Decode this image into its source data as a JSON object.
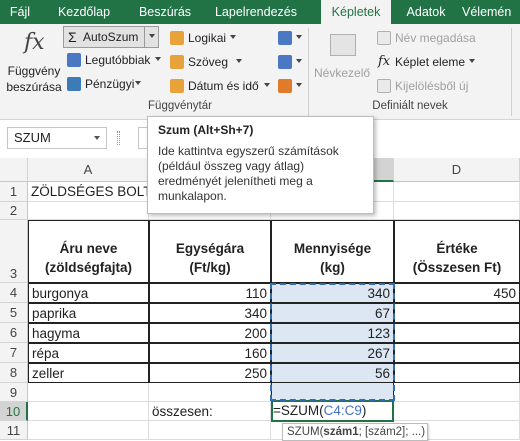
{
  "ribbon_tabs": [
    "Fájl",
    "Kezdőlap",
    "Beszúrás",
    "Lapelrendezés",
    "Képletek",
    "Adatok",
    "Vélemén"
  ],
  "ribbon": {
    "insert_function_label_1": "Függvény",
    "insert_function_label_2": "beszúrása",
    "autosum": "AutoSzum",
    "recent": "Legutóbbiak",
    "financial": "Pénzügyi",
    "logical": "Logikai",
    "text": "Szöveg",
    "datetime": "Dátum és idő",
    "name_manager": "Névkezelő",
    "define_name": "Név megadása",
    "use_in_formula": "Képlet eleme",
    "create_from_selection": "Kijelölésből új",
    "group_library": "Függvénytár",
    "group_names": "Definiált nevek"
  },
  "formula_bar": {
    "name_box": "SZUM"
  },
  "tooltip": {
    "title": "Szum (Alt+Sh+7)",
    "lines": [
      "Ide kattintva egyszerű számítások",
      "(például összeg vagy átlag)",
      "eredményét jelenítheti meg a",
      "munkalapon."
    ]
  },
  "columns": [
    "A",
    "B",
    "C",
    "D"
  ],
  "rows": [
    "1",
    "2",
    "3",
    "4",
    "5",
    "6",
    "7",
    "8",
    "9",
    "10",
    "11"
  ],
  "sheet": {
    "a1": "ZÖLDSÉGES BOLT",
    "h_a": [
      "Áru neve",
      "(zöldségfajta)"
    ],
    "h_b": [
      "Egységára",
      "(Ft/kg)"
    ],
    "h_c": [
      "Mennyisége",
      "(kg)"
    ],
    "h_d": [
      "Értéke",
      "(Összesen Ft)"
    ],
    "items": [
      {
        "name": "burgonya",
        "price": "110",
        "qty": "340",
        "value": "450"
      },
      {
        "name": "paprika",
        "price": "340",
        "qty": "67",
        "value": ""
      },
      {
        "name": "hagyma",
        "price": "200",
        "qty": "123",
        "value": ""
      },
      {
        "name": "répa",
        "price": "160",
        "qty": "267",
        "value": ""
      },
      {
        "name": "zeller",
        "price": "250",
        "qty": "56",
        "value": ""
      }
    ],
    "b10": "összesen:",
    "formula_prefix": "=SZUM(",
    "formula_ref": "C4:C9",
    "formula_suffix": ")",
    "hint_fn": "SZUM(",
    "hint_arg1": "szám1",
    "hint_rest": "; [szám2]; ...)"
  },
  "colors": {
    "accent": "#217346",
    "ref": "#4472c4",
    "range_fill": "#dde7f3"
  }
}
